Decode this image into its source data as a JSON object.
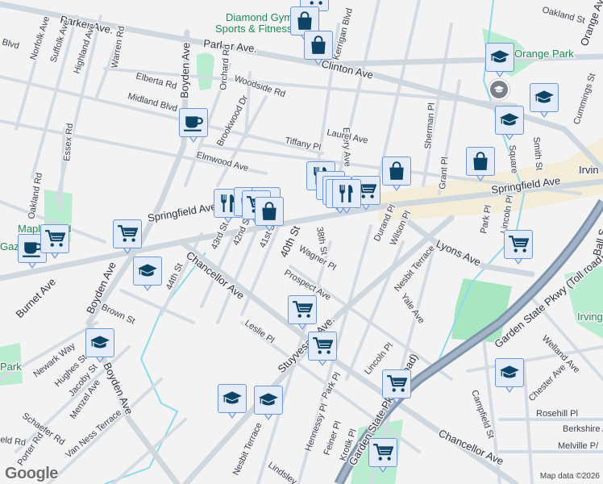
{
  "map": {
    "streets": {
      "parker_ave_1": "Parker Ave.",
      "parker_ave_2": "Parker Ave.",
      "norfolk_ave": "Norfolk Ave",
      "suffolk_ave": "Suffolk Ave",
      "highland_ave": "Highland Ave",
      "warren_rd": "Warren Rd",
      "blvd": "Blvd",
      "elberta_rd": "Elberta Rd",
      "midland_blvd": "Midland Blvd",
      "boyden_ave_1": "Boyden Ave",
      "boyden_ave_2": "Boyden Ave",
      "boyden_ave_3": "Boyden Ave",
      "orchard_rd": "Orchard Rd",
      "woodside_rd": "Woodside Rd",
      "brookwood_dr": "Brookwood Dr",
      "elmwood_ave": "Elmwood Ave",
      "essex_rd": "Essex Rd",
      "oakland_rd": "Oakland Rd",
      "kerrigan_blvd": "Kerrigan Blvd",
      "clinton_ave": "Clinton Ave",
      "ellery_ave": "Ellery Ave",
      "laurel_ave": "Laurel Ave",
      "tiffany_pl": "Tiffany Pl",
      "sherman_pl": "Sherman Pl",
      "grant_pl": "Grant Pl",
      "oakland_st": "Oakland St",
      "orange_ave": "Orange Ave",
      "cummings_st": "Cummings St",
      "smith_st": "Smith St",
      "square": "Square",
      "springfield_ave_1": "Springfield Ave",
      "springfield_ave_2": "Springfield Ave",
      "park_pl_1": "Park Pl",
      "lincoln_pl_1": "Lincoln Pl",
      "durand_pl": "Durand Pl",
      "wilson_pl": "Wilson Pl",
      "38th_st": "38th St",
      "40th_st": "40th St",
      "41st_st": "41st St",
      "42nd_st": "42nd St",
      "43rd_st": "43rd St",
      "44th_st": "44th St",
      "wagner_pl": "Wagner Pl",
      "prospect_ave": "Prospect Ave",
      "lyons_ave": "Lyons Ave",
      "nesbit_terrace_1": "Nesbit Terrace",
      "nesbit_terrace_2": "Nesbit Terrace",
      "yale_ave": "Yale Ave",
      "chancellor_ave_1": "Chancellor Ave",
      "chancellor_ave_2": "Chancellor Ave",
      "burnet_ave": "Burnet Ave",
      "brown_st": "Brown St",
      "leslie_pl": "Leslie Pl",
      "stuyvesant_ave": "Stuyvesant Ave.",
      "newark_way": "Newark Way",
      "hughes_st": "Hughes St",
      "jacoby_st": "Jacoby St",
      "menzel_ave": "Menzel Ave",
      "schaefer_rd": "Schaefer Rd",
      "van_ness_terrace": "Van Ness Terrace",
      "porter_rd": "Porter Rd",
      "field_rd": "eld Rd",
      "lincoln_pl_2": "Lincoln Pl",
      "park_pl_2": "Park Pl",
      "hennessy_pl": "Hennessy Pl",
      "feiner_pl": "Feiner Pl",
      "krotik_pl": "Krotik Pl",
      "garden_state_1": "Garden State Pkwy (Toll road)",
      "garden_state_2": "Garden State Pk (Toll road)",
      "welland_ave": "Welland Ave",
      "chester_ave": "Chester Ave",
      "campfield_st": "Campfield St",
      "rosehill_pl": "Rosehill Pl",
      "berkshire": "Berkshire A",
      "melville_pl": "Melville P/",
      "ball_st": "Ball S",
      "lindsley": "Lindsley",
      "irvington": "Irvin"
    },
    "pois": {
      "diamond_gym": "Diamond Gym",
      "sports_fitness": "Sports & Fitness",
      "orange_park": "Orange Park",
      "irving_park": "Irving",
      "maplewood": "Maplewood",
      "gazebo": "Gazebo",
      "park": "Park"
    },
    "attribution": "Map data ©2026",
    "logo": "Google"
  },
  "markers": [
    {
      "type": "cart"
    },
    {
      "type": "shop"
    },
    {
      "type": "shop"
    },
    {
      "type": "coffee"
    },
    {
      "type": "school"
    },
    {
      "type": "school"
    },
    {
      "type": "school"
    },
    {
      "type": "shop"
    },
    {
      "type": "shop"
    },
    {
      "type": "restaurant"
    },
    {
      "type": "restaurant"
    },
    {
      "type": "cart"
    },
    {
      "type": "restaurant"
    },
    {
      "type": "restaurant"
    },
    {
      "type": "restaurant"
    },
    {
      "type": "restaurant"
    },
    {
      "type": "shop"
    },
    {
      "type": "shop"
    },
    {
      "type": "cart"
    },
    {
      "type": "shop"
    },
    {
      "type": "cart"
    },
    {
      "type": "coffee"
    },
    {
      "type": "school"
    },
    {
      "type": "cart"
    },
    {
      "type": "cart"
    },
    {
      "type": "cart"
    },
    {
      "type": "school"
    },
    {
      "type": "cart"
    },
    {
      "type": "cart"
    },
    {
      "type": "school"
    },
    {
      "type": "school"
    },
    {
      "type": "school"
    }
  ],
  "colors": {
    "marker_icon": "#0d4466",
    "marker_bg": "#e3ebf8",
    "marker_border": "#6f97d8",
    "park": "#a8e6c2",
    "water": "#8ed9ec",
    "highway": "#8096ae"
  }
}
